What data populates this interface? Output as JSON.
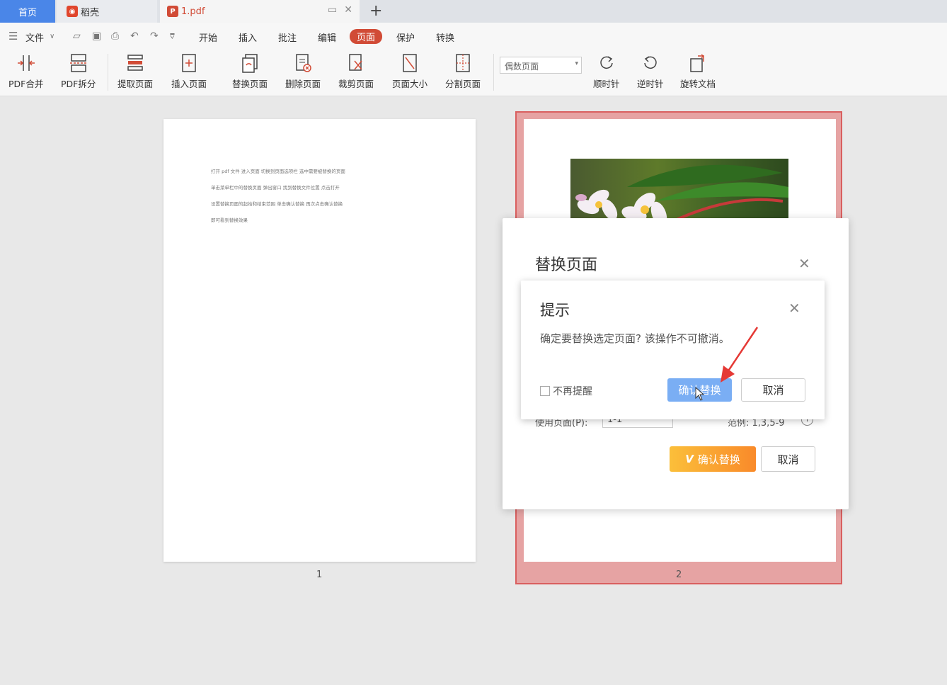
{
  "tabs": {
    "home": "首页",
    "daoke": "稻壳",
    "pdf": "1.pdf",
    "add": "+"
  },
  "menu": {
    "file": "文件",
    "items": [
      "开始",
      "插入",
      "批注",
      "编辑",
      "页面",
      "保护",
      "转换"
    ],
    "active": "页面"
  },
  "ribbon": {
    "merge": "PDF合并",
    "split": "PDF拆分",
    "extract": "提取页面",
    "insert": "插入页面",
    "replace": "替换页面",
    "delete": "删除页面",
    "crop": "裁剪页面",
    "size": "页面大小",
    "divide": "分割页面",
    "page_select": "偶数页面",
    "rotate_cw": "顺时针",
    "rotate_ccw": "逆时针",
    "rotate_doc": "旋转文档"
  },
  "page1": {
    "lines": [
      "打开 pdf 文件   进入页面   切换到页面选项栏   选中需要被替换的页面",
      "单击菜单栏中的替换页面   弹出窗口   找到替换文件位置   点击打开",
      "设置替换页面的起始和结束范围   单击确认替换   再次点击确认替换",
      "即可看到替换效果"
    ],
    "number": "1"
  },
  "page2": {
    "number": "2"
  },
  "dialog_replace": {
    "title": "替换页面",
    "confirm": "确认替换",
    "cancel": "取消",
    "partial_label": "使用页面(P):",
    "partial_value": "1-1",
    "partial_example": "范例: 1,3,5-9"
  },
  "dialog_tip": {
    "title": "提示",
    "message": "确定要替换选定页面? 该操作不可撤消。",
    "no_remind": "不再提醒",
    "confirm": "确认替换",
    "cancel": "取消"
  }
}
